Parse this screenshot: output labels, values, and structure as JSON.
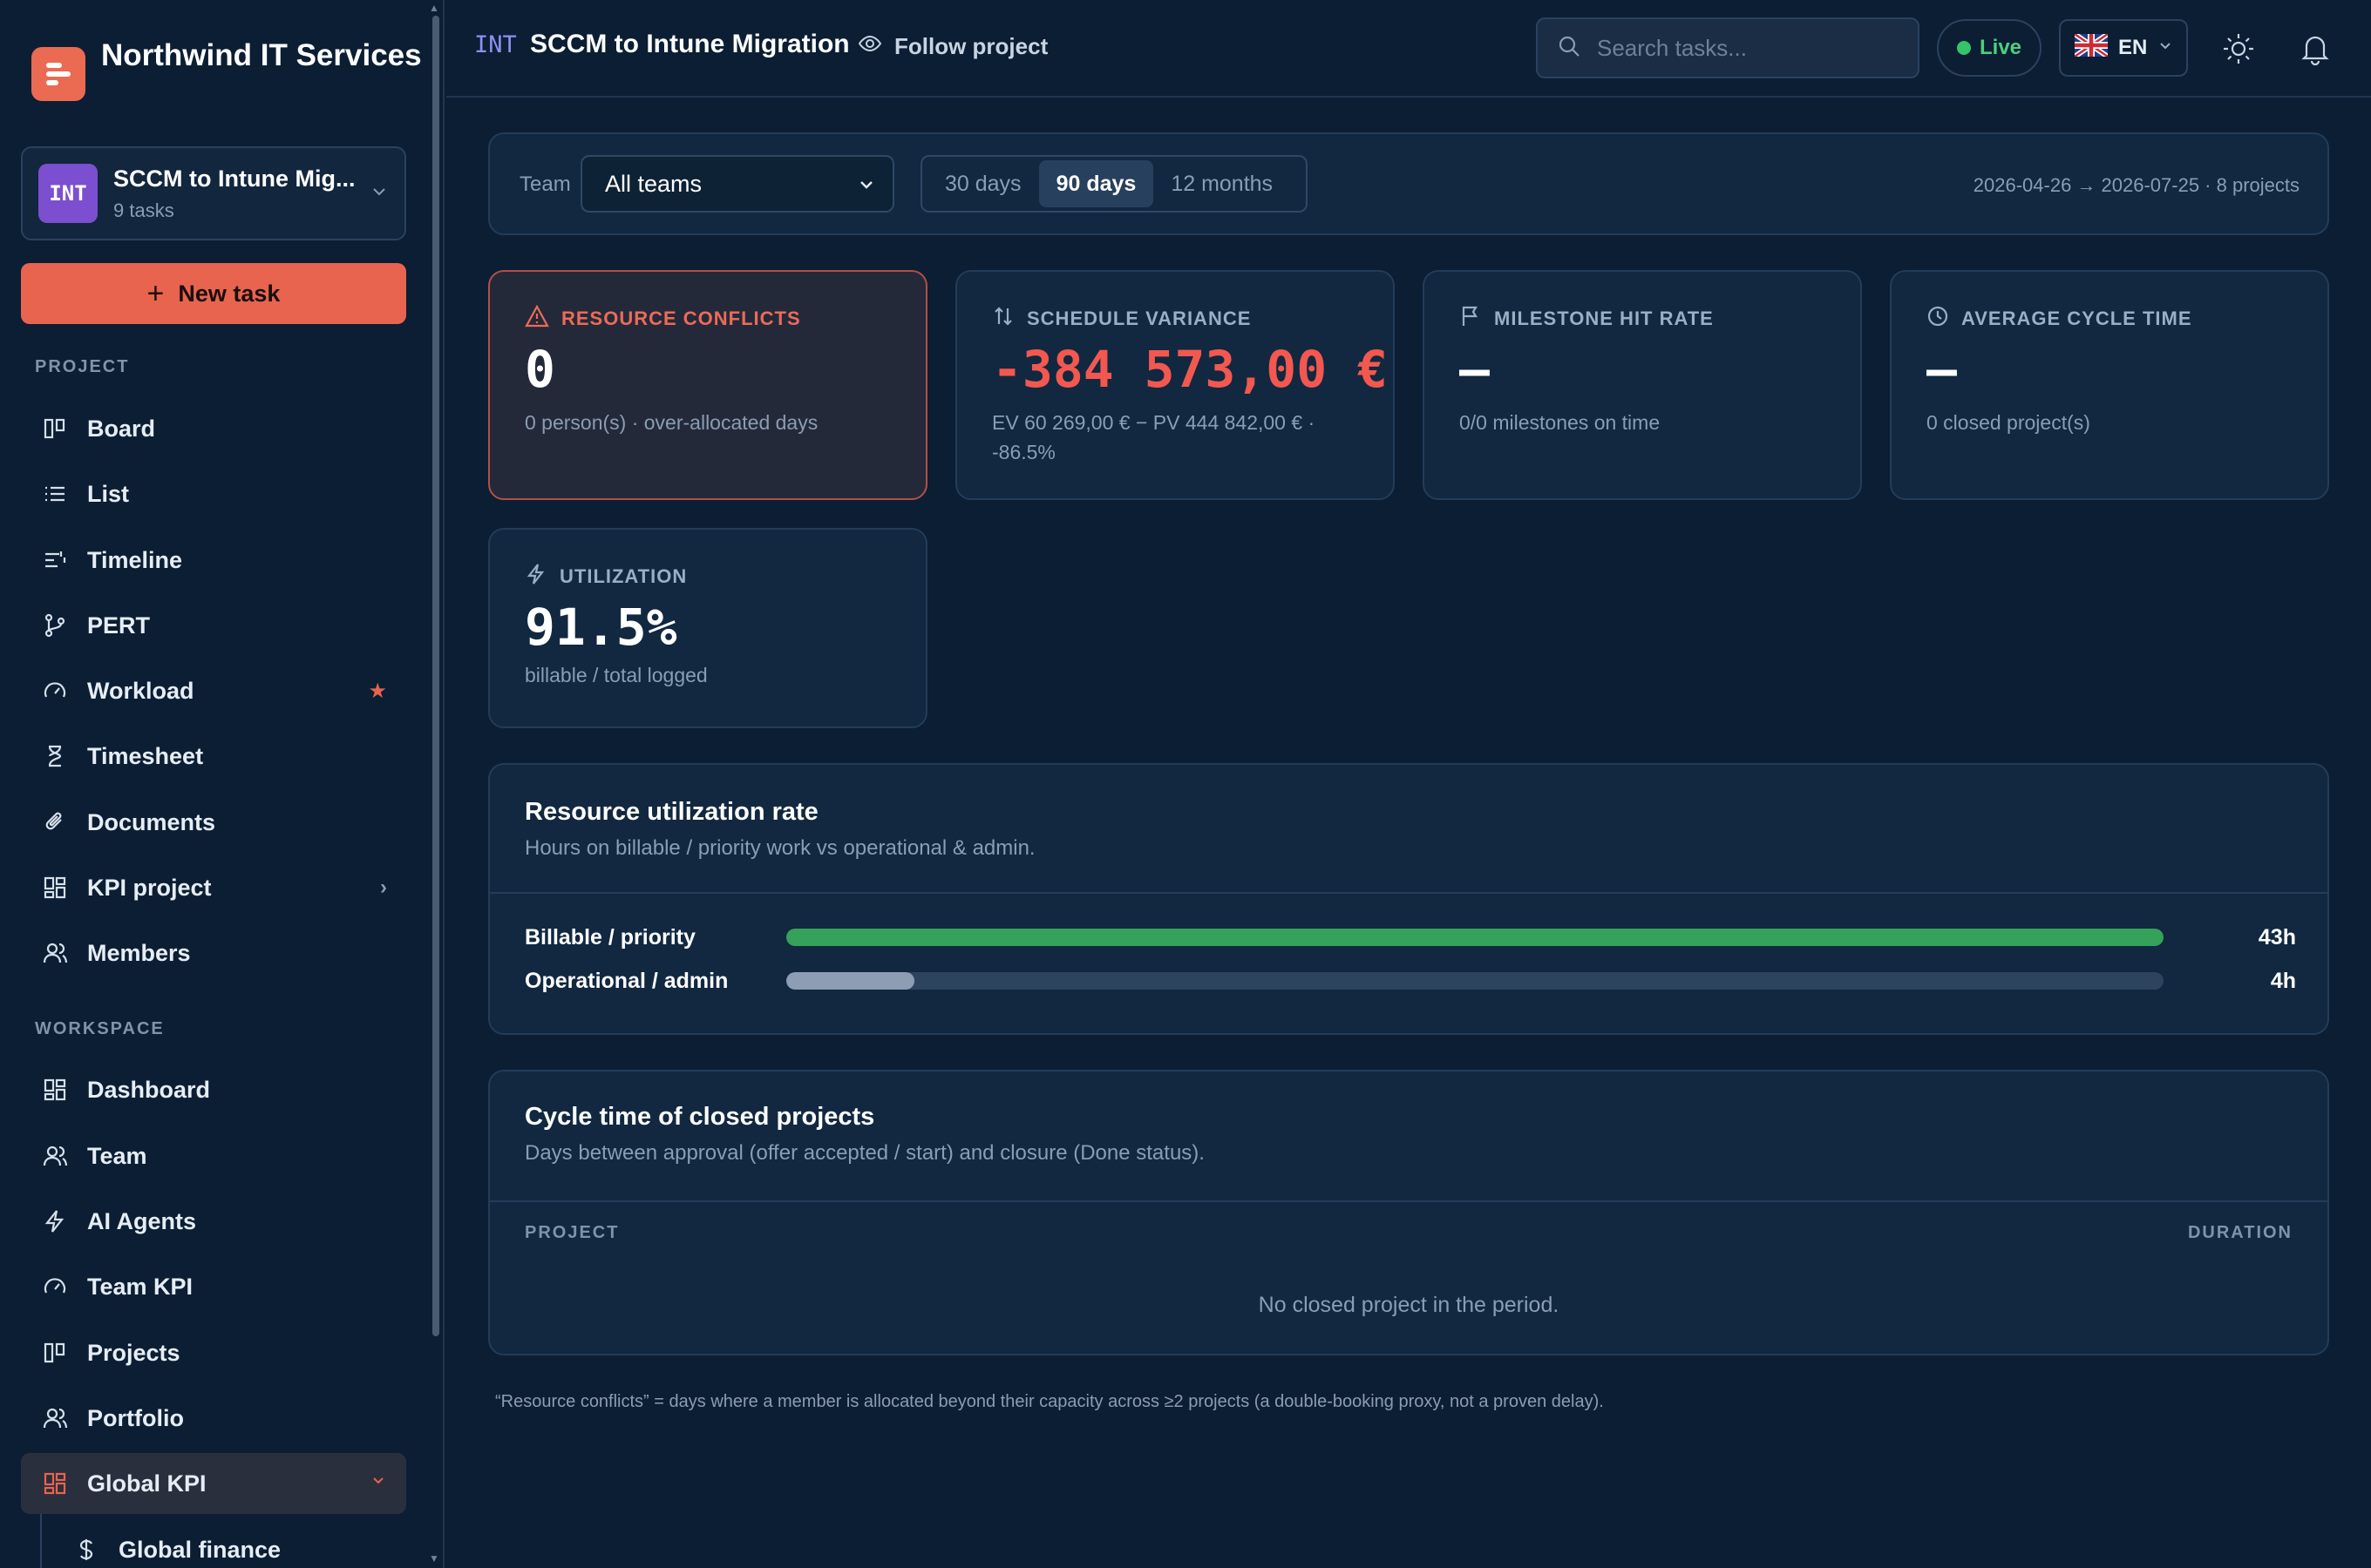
{
  "sidebar": {
    "brand": "Northwind IT Services",
    "project_switcher": {
      "code": "INT",
      "name": "SCCM to Intune Mig...",
      "count": "9 tasks"
    },
    "new_task": "New task",
    "section_project": "PROJECT",
    "project_items": [
      {
        "label": "Board",
        "icon": "board-icon"
      },
      {
        "label": "List",
        "icon": "list-icon"
      },
      {
        "label": "Timeline",
        "icon": "timeline-icon"
      },
      {
        "label": "PERT",
        "icon": "pert-icon"
      },
      {
        "label": "Workload",
        "icon": "gauge-icon",
        "trail": "★"
      },
      {
        "label": "Timesheet",
        "icon": "hourglass-icon"
      },
      {
        "label": "Documents",
        "icon": "paperclip-icon"
      },
      {
        "label": "KPI project",
        "icon": "dashboard-icon",
        "trail": "›"
      },
      {
        "label": "Members",
        "icon": "users-icon"
      }
    ],
    "section_workspace": "WORKSPACE",
    "workspace_items": [
      {
        "label": "Dashboard",
        "icon": "dashboard-icon"
      },
      {
        "label": "Team",
        "icon": "users-icon"
      },
      {
        "label": "AI Agents",
        "icon": "lightning-icon"
      },
      {
        "label": "Team KPI",
        "icon": "gauge-icon"
      },
      {
        "label": "Projects",
        "icon": "board-icon"
      },
      {
        "label": "Portfolio",
        "icon": "users-icon"
      },
      {
        "label": "Global KPI",
        "icon": "dashboard-icon",
        "trail": "⌄",
        "active": true
      },
      {
        "label": "Global finance",
        "icon": "dollar-icon"
      }
    ]
  },
  "topbar": {
    "code": "INT",
    "title": "SCCM to Intune Migration",
    "follow": "Follow project",
    "search_placeholder": "Search tasks...",
    "live": "Live",
    "lang": "EN"
  },
  "filters": {
    "team_label": "Team",
    "team_value": "All teams",
    "ranges": [
      "30 days",
      "90 days",
      "12 months"
    ],
    "active_range": "90 days",
    "meta": "2026-04-26 → 2026-07-25 · 8 projects"
  },
  "kpis": {
    "conflicts": {
      "title": "RESOURCE CONFLICTS",
      "value": "0",
      "sub": "0 person(s) · over-allocated days"
    },
    "variance": {
      "title": "SCHEDULE VARIANCE",
      "value": "-384 573,00 €",
      "sub": "EV 60 269,00 € − PV 444 842,00 € · -86.5%"
    },
    "milestone": {
      "title": "MILESTONE HIT RATE",
      "value": "—",
      "sub": "0/0 milestones on time"
    },
    "cycle": {
      "title": "AVERAGE CYCLE TIME",
      "value": "—",
      "sub": "0 closed project(s)"
    },
    "utilization": {
      "title": "UTILIZATION",
      "value": "91.5%",
      "sub": "billable / total logged"
    }
  },
  "utilization_card": {
    "title": "Resource utilization rate",
    "subtitle": "Hours on billable / priority work vs operational & admin.",
    "rows": [
      {
        "label": "Billable / priority",
        "value": "43h",
        "fraction": 1.0,
        "color": "#35a25a"
      },
      {
        "label": "Operational / admin",
        "value": "4h",
        "fraction": 0.093,
        "color": "#8d9db4"
      }
    ]
  },
  "cycle_card": {
    "title": "Cycle time of closed projects",
    "subtitle": "Days between approval (offer accepted / start) and closure (Done status).",
    "col_project": "PROJECT",
    "col_duration": "DURATION",
    "empty": "No closed project in the period."
  },
  "footnote": "“Resource conflicts” = days where a member is allocated beyond their capacity across ≥2 projects (a double-booking proxy, not a proven delay).",
  "colors": {
    "accent": "#e8644e",
    "danger": "#f2584f",
    "live": "#35c46a",
    "bg": "#0b1e33"
  }
}
